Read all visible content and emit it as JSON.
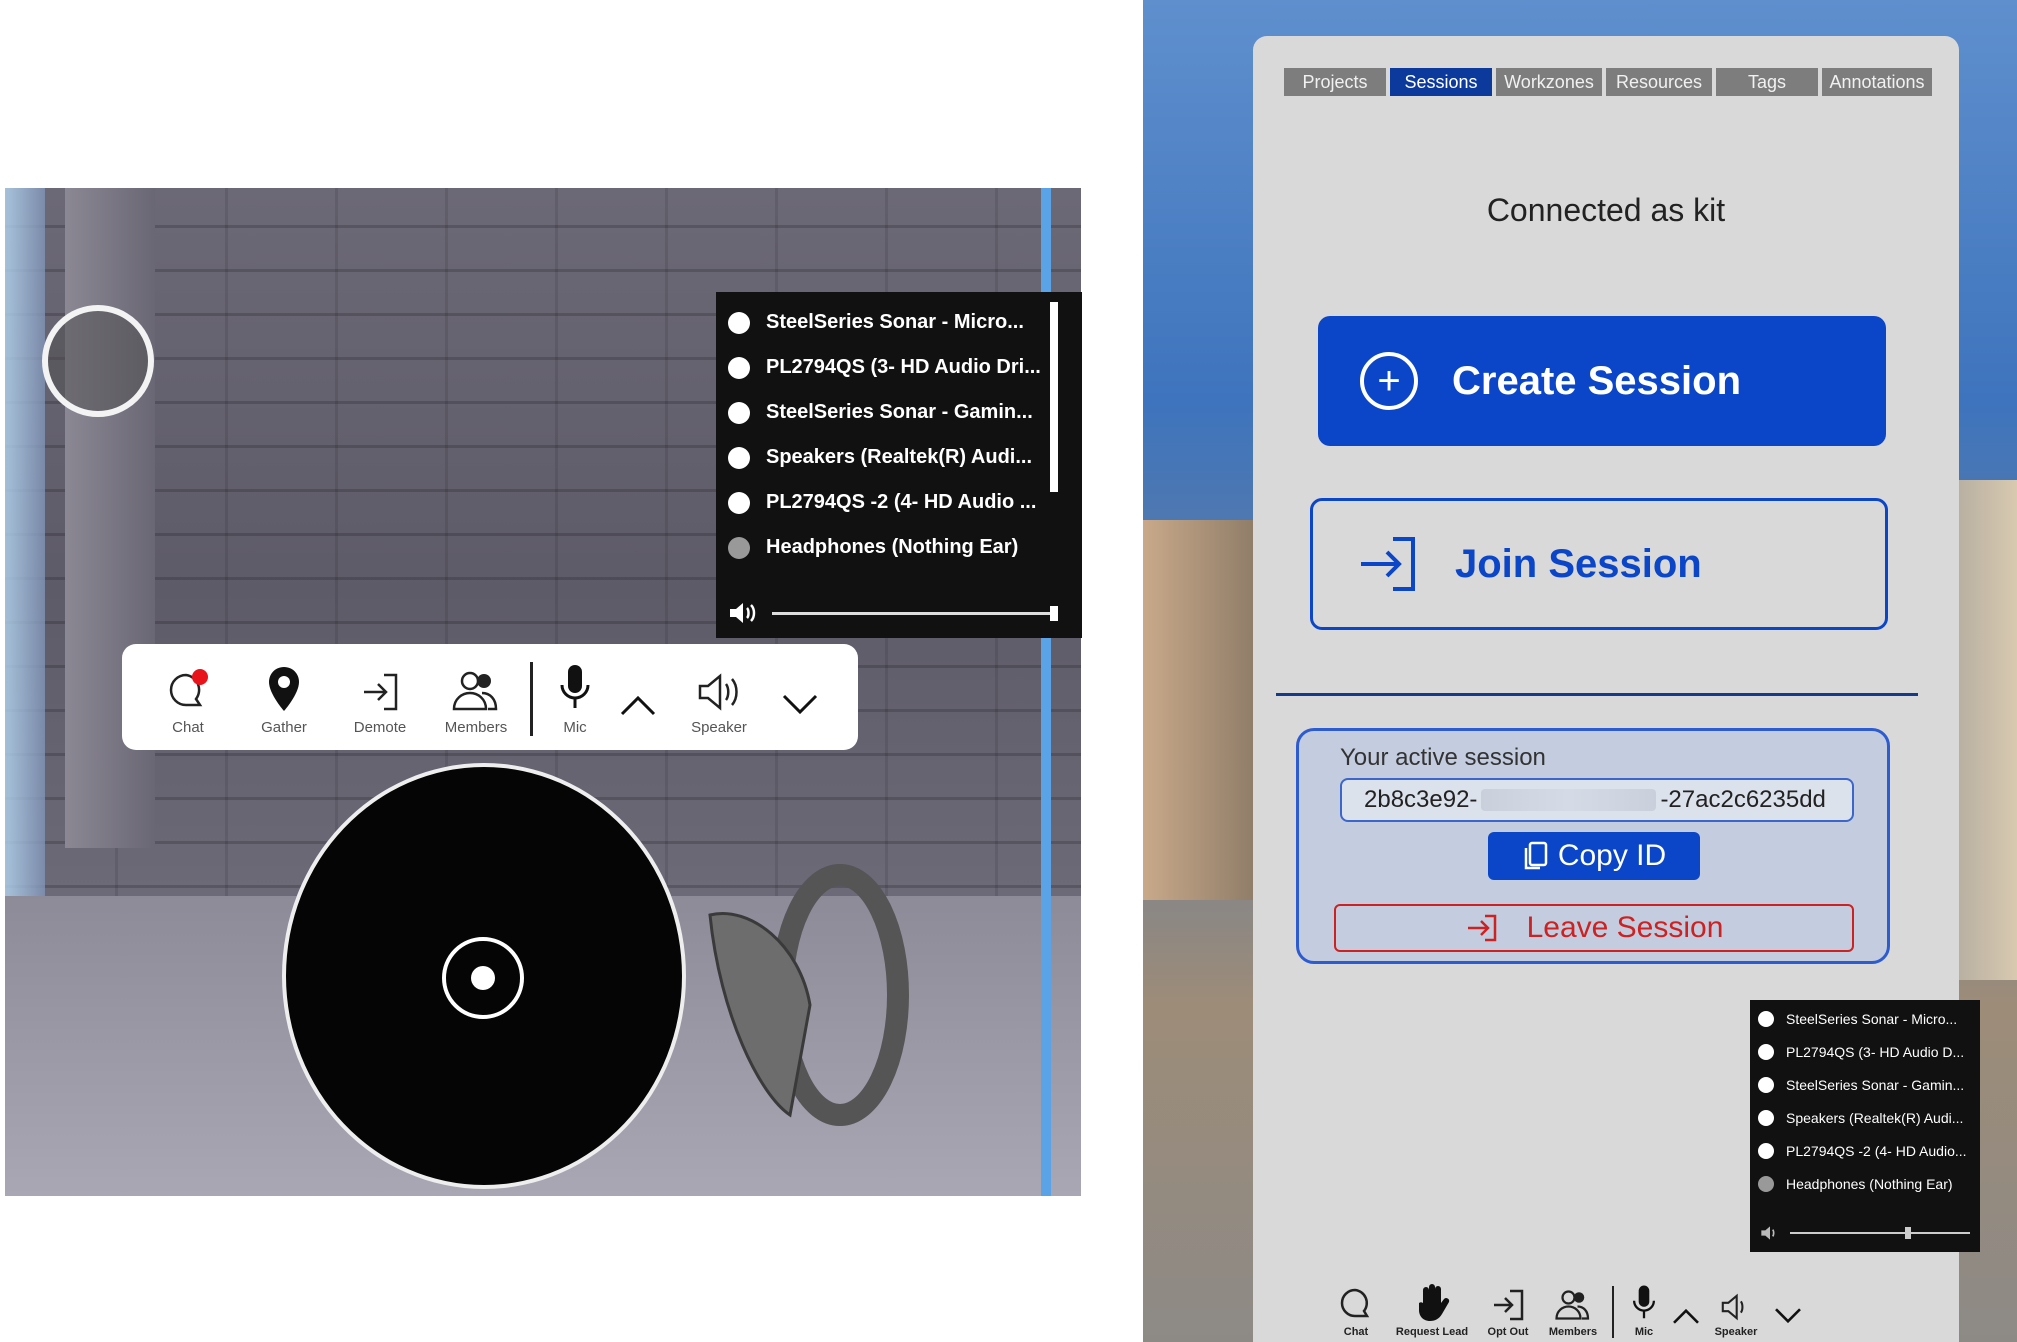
{
  "left_view": {
    "audio_devices": {
      "items": [
        {
          "label": "SteelSeries Sonar - Micro...",
          "selected": false
        },
        {
          "label": "PL2794QS (3- HD Audio Dri...",
          "selected": false
        },
        {
          "label": "SteelSeries Sonar - Gamin...",
          "selected": false
        },
        {
          "label": "Speakers (Realtek(R) Audi...",
          "selected": false
        },
        {
          "label": "PL2794QS -2 (4- HD Audio ...",
          "selected": false
        },
        {
          "label": "Headphones (Nothing Ear)",
          "selected": true
        }
      ],
      "volume_icon": "speaker-icon",
      "volume_level": 1.0
    },
    "toolbar": {
      "chat": "Chat",
      "gather": "Gather",
      "demote": "Demote",
      "members": "Members",
      "mic": "Mic",
      "speaker": "Speaker",
      "chat_notification_color": "#e8141b"
    }
  },
  "right_view": {
    "tabs": [
      "Projects",
      "Sessions",
      "Workzones",
      "Resources",
      "Tags",
      "Annotations"
    ],
    "active_tab": "Sessions",
    "connected_text": "Connected as kit",
    "create_session": "Create Session",
    "join_session": "Join Session",
    "active_session_label": "Your active session",
    "session_id_start": "2b8c3e92-",
    "session_id_end": "-27ac2c6235dd",
    "copy_id": "Copy ID",
    "leave_session": "Leave Session",
    "audio_devices": {
      "items": [
        {
          "label": "SteelSeries Sonar - Micro...",
          "selected": false
        },
        {
          "label": "PL2794QS (3- HD Audio D...",
          "selected": false
        },
        {
          "label": "SteelSeries Sonar - Gamin...",
          "selected": false
        },
        {
          "label": "Speakers (Realtek(R) Audi...",
          "selected": false
        },
        {
          "label": "PL2794QS -2 (4- HD Audio...",
          "selected": false
        },
        {
          "label": "Headphones (Nothing Ear)",
          "selected": true
        }
      ],
      "volume_level": 0.55
    },
    "toolbar": {
      "chat": "Chat",
      "request_lead": "Request Lead",
      "opt_out": "Opt Out",
      "members": "Members",
      "mic": "Mic",
      "speaker": "Speaker"
    }
  },
  "colors": {
    "primary_blue": "#0b46c9",
    "active_tab": "#0c3a9c",
    "leave_red": "#cc2222",
    "panel_bg": "#d9d9d9"
  }
}
